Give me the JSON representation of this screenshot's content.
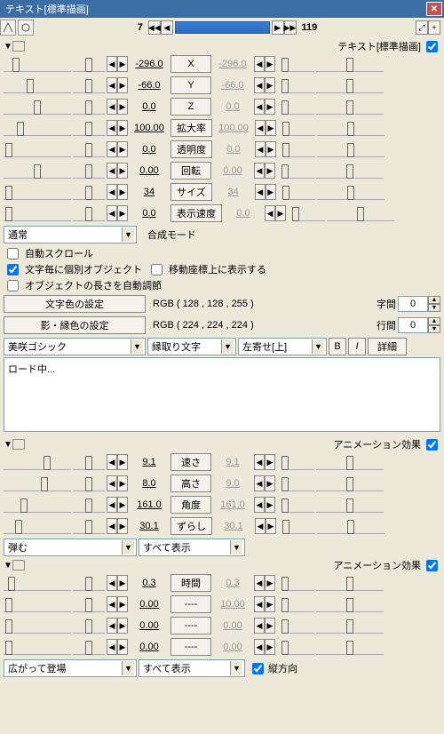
{
  "window": {
    "title": "テキスト[標準描画]"
  },
  "timeline": {
    "start": "7",
    "end": "119"
  },
  "sections": [
    {
      "label": "テキスト[標準描画]",
      "checked": true,
      "params": [
        {
          "label": "X",
          "l": "-296.0",
          "r": "-296.0",
          "lpos": 18,
          "rpos": 8
        },
        {
          "label": "Y",
          "l": "-66.0",
          "r": "-66.0",
          "lpos": 40,
          "rpos": 8
        },
        {
          "label": "Z",
          "l": "0.0",
          "r": "0.0",
          "lpos": 50,
          "rpos": 8
        },
        {
          "label": "拡大率",
          "l": "100.00",
          "r": "100.00",
          "lpos": 25,
          "rpos": 8
        },
        {
          "label": "透明度",
          "l": "0.0",
          "r": "0.0",
          "lpos": 8,
          "rpos": 8
        },
        {
          "label": "回転",
          "l": "0.00",
          "r": "0.00",
          "lpos": 50,
          "rpos": 8
        },
        {
          "label": "サイズ",
          "l": "34",
          "r": "34",
          "lpos": 8,
          "rpos": 8
        },
        {
          "label": "表示速度",
          "l": "0.0",
          "r": "0.0",
          "lpos": 8,
          "rpos": 8
        }
      ]
    },
    {
      "label": "アニメーション効果",
      "checked": true,
      "params": [
        {
          "label": "速さ",
          "l": "9.1",
          "r": "9.1",
          "lpos": 65,
          "rpos": 8
        },
        {
          "label": "高さ",
          "l": "8.0",
          "r": "9.0",
          "lpos": 60,
          "rpos": 8
        },
        {
          "label": "角度",
          "l": "161.0",
          "r": "161.0",
          "lpos": 30,
          "rpos": 8
        },
        {
          "label": "ずらし",
          "l": "30.1",
          "r": "30.1",
          "lpos": 22,
          "rpos": 8
        }
      ]
    },
    {
      "label": "アニメーション効果",
      "checked": true,
      "params": [
        {
          "label": "時間",
          "l": "0.3",
          "r": "0.3",
          "lpos": 12,
          "rpos": 8
        },
        {
          "label": "----",
          "l": "0.00",
          "r": "10.00",
          "lpos": 8,
          "rpos": 8
        },
        {
          "label": "----",
          "l": "0.00",
          "r": "0.00",
          "lpos": 8,
          "rpos": 8
        },
        {
          "label": "----",
          "l": "0.00",
          "r": "0.00",
          "lpos": 8,
          "rpos": 8
        }
      ]
    }
  ],
  "blend": {
    "label": "合成モード",
    "mode": "通常"
  },
  "checks": {
    "auto_scroll": "自動スクロール",
    "per_char_obj": "文字毎に個別オブジェクト",
    "show_on_move_coords": "移動座標上に表示する",
    "auto_length": "オブジェクトの長さを自動調節",
    "vertical": "縦方向"
  },
  "color": {
    "text_btn": "文字色の設定",
    "text_rgb": "RGB ( 128 , 128 , 255 )",
    "edge_btn": "影・縁色の設定",
    "edge_rgb": "RGB ( 224 , 224 , 224 )",
    "char_spacing_label": "字間",
    "char_spacing": "0",
    "line_spacing_label": "行間",
    "line_spacing": "0"
  },
  "font": {
    "name": "美咲ゴシック",
    "decoration": "縁取り文字",
    "align": "左寄せ[上]",
    "bold": "B",
    "italic": "I",
    "detail": "詳細"
  },
  "textarea": "ロード中...",
  "anim1": {
    "type": "弾む",
    "show": "すべて表示"
  },
  "anim2": {
    "type": "広がって登場",
    "show": "すべて表示"
  }
}
